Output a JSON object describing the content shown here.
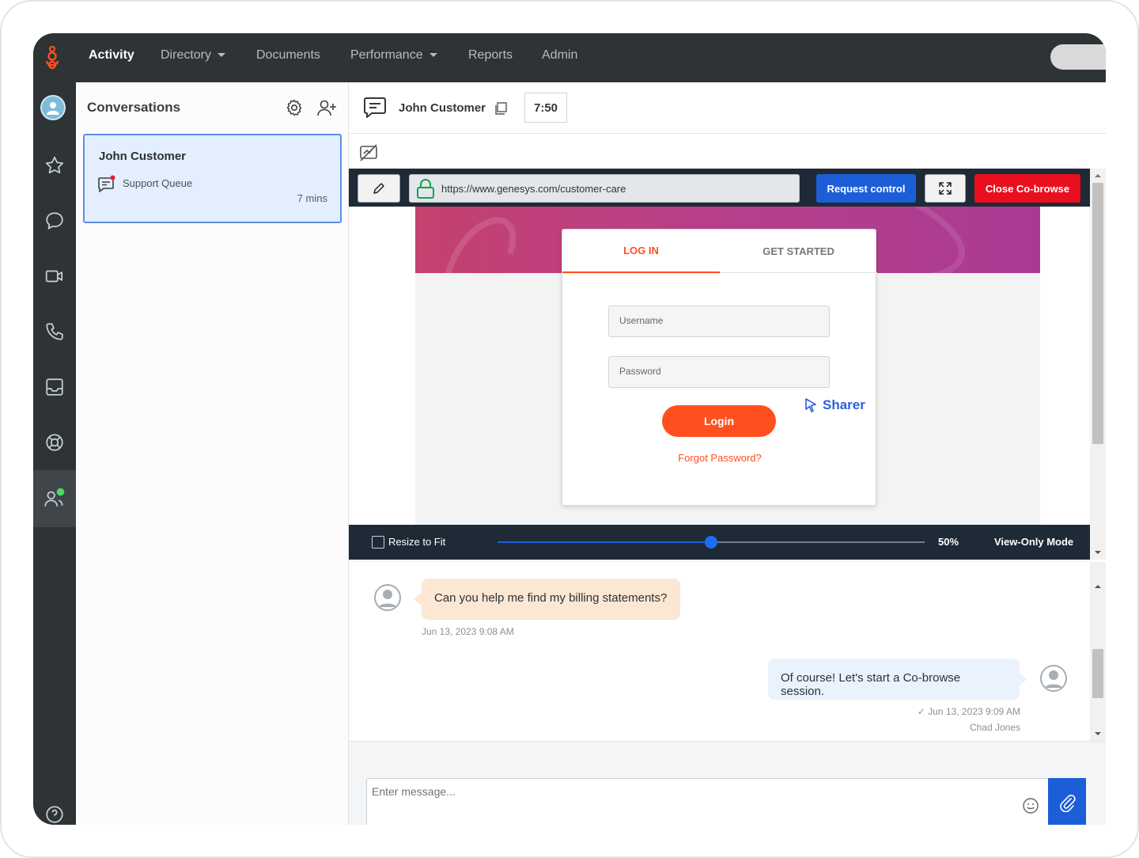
{
  "nav": {
    "items": [
      {
        "label": "Activity"
      },
      {
        "label": "Directory"
      },
      {
        "label": "Documents"
      },
      {
        "label": "Performance"
      },
      {
        "label": "Reports"
      },
      {
        "label": "Admin"
      }
    ],
    "active": "Activity"
  },
  "rail": {
    "icons": [
      "user-avatar-icon",
      "star-icon",
      "chat-bubble-icon",
      "video-icon",
      "phone-icon",
      "inbox-icon",
      "lifebuoy-icon",
      "agent-status-icon",
      "help-icon"
    ],
    "active": "agent-status-icon"
  },
  "conversations": {
    "title": "Conversations",
    "cards": [
      {
        "name": "John Customer",
        "queue": "Support Queue",
        "time": "7 mins"
      }
    ]
  },
  "interaction": {
    "name": "John Customer",
    "timer": "7:50"
  },
  "cobrowse": {
    "url": "https://www.genesys.com/customer-care",
    "request_control_label": "Request control",
    "close_label": "Close Co-browse",
    "resize_to_fit_label": "Resize to Fit",
    "resize_to_fit_checked": false,
    "zoom_percent": 50,
    "zoom_label": "50%",
    "mode_label": "View-Only Mode",
    "site": {
      "tab_login": "LOG IN",
      "tab_get_started": "GET STARTED",
      "username_placeholder": "Username",
      "password_placeholder": "Password",
      "login_button": "Login",
      "forgot_link": "Forgot Password?",
      "sharer_label": "Sharer"
    }
  },
  "chat": {
    "messages": [
      {
        "direction": "inbound",
        "text": "Can you help me find my billing statements?",
        "timestamp": "Jun 13, 2023 9:08 AM"
      },
      {
        "direction": "outbound",
        "text": "Of course! Let's start a Co-browse session.",
        "timestamp": "✓ Jun 13, 2023 9:09 AM",
        "author": "Chad Jones"
      }
    ]
  },
  "composer": {
    "placeholder": "Enter message..."
  },
  "colors": {
    "nav_bg": "#2e3336",
    "brand_orange": "#ff4f1f",
    "primary_blue": "#1c5ed8",
    "danger_red": "#ea0f1e",
    "card_selected_bg": "#e3eefe"
  }
}
